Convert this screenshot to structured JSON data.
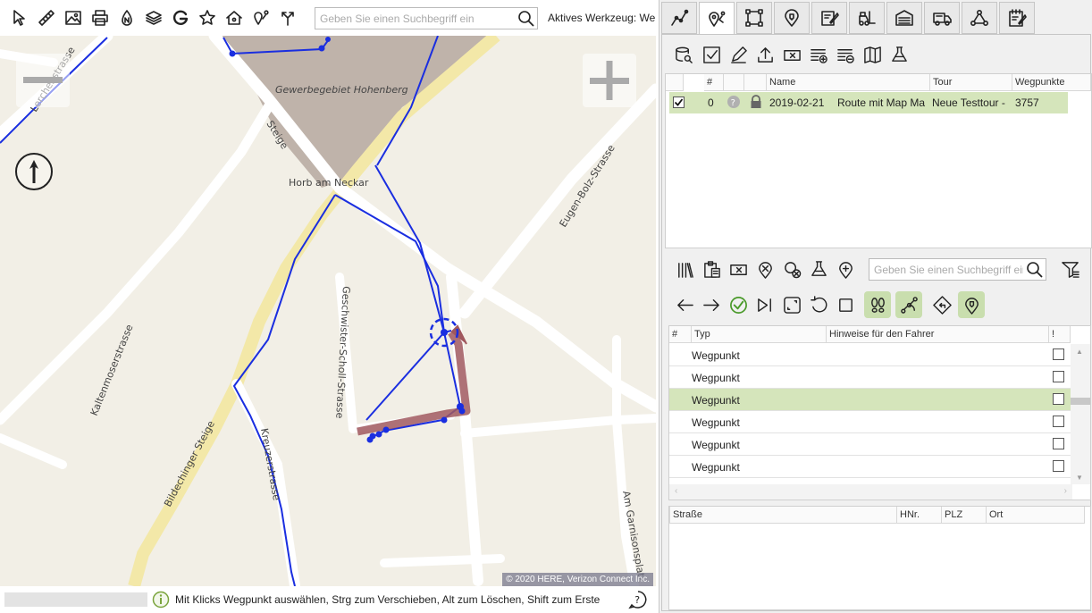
{
  "toolbar": {
    "icons": [
      "pointer-icon",
      "ruler-icon",
      "image-icon",
      "print-icon",
      "north-icon",
      "layers-icon",
      "google-icon",
      "star-icon",
      "home-pin-icon",
      "pin-route-icon",
      "routing-icon"
    ],
    "search_placeholder": "Geben Sie einen Suchbegriff ein",
    "active_tool": "Aktives Werkzeug: We"
  },
  "map": {
    "labels": {
      "area": "Gewerbegebiet Hohenberg",
      "town": "Horb am Neckar",
      "lerchenstrasse": "Lerchenstrasse",
      "steige": "Steige",
      "eugen_bolz": "Eugen-Bolz-Strasse",
      "geschwister": "Geschwister-Scholl-Strasse",
      "kaltenmoser": "Kaltenmoserstrasse",
      "bildechinger": "Bildechinger Steige",
      "kreuzer": "Kreuzerstrasse",
      "garnison": "Am Garnisonsplatz"
    },
    "copyright": "© 2020 HERE, Verizon Connect Inc.",
    "route_color": "#1a2ee0",
    "highlight_color": "#a0585e",
    "area_color": "#bfb3aa"
  },
  "status": {
    "text": "Mit Klicks Wegpunkt auswählen, Strg zum Verschieben, Alt zum Löschen, Shift zum Erste"
  },
  "tabs": [
    "route-tab",
    "waypoint-tab",
    "area-tab",
    "poi-tab",
    "edit-tab",
    "vehicle-tab",
    "depot-tab",
    "truck-tab",
    "network-tab",
    "notes-tab"
  ],
  "tours": {
    "columns": [
      "#",
      "Name",
      "Tour",
      "Wegpunkte"
    ],
    "rows": [
      {
        "checked": true,
        "num": "0",
        "date": "2019-02-21",
        "name": "Route mit Map Ma",
        "tour": "Neue Testtour -",
        "waypoints": "3757"
      }
    ]
  },
  "waypoints": {
    "search_placeholder": "Geben Sie einen Suchbegriff ein",
    "columns": [
      "#",
      "Typ",
      "Hinweise für den Fahrer",
      "!"
    ],
    "rows": [
      {
        "type": "Wegpunkt",
        "selected": false
      },
      {
        "type": "Wegpunkt",
        "selected": false
      },
      {
        "type": "Wegpunkt",
        "selected": true
      },
      {
        "type": "Wegpunkt",
        "selected": false
      },
      {
        "type": "Wegpunkt",
        "selected": false
      },
      {
        "type": "Wegpunkt",
        "selected": false
      },
      {
        "type": "Wegpunkt",
        "selected": false
      }
    ]
  },
  "address": {
    "columns": [
      "Straße",
      "HNr.",
      "PLZ",
      "Ort"
    ]
  },
  "accent": "#d5e5bb"
}
